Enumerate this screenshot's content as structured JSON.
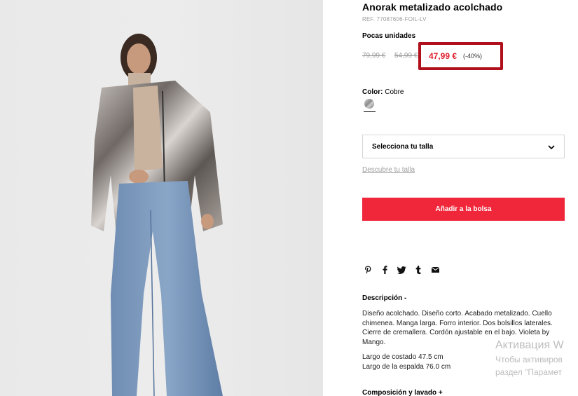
{
  "product": {
    "title": "Anorak metalizado acolchado",
    "ref": "REF. 77087606-FOIL-LV",
    "stock_status": "Pocas unidades",
    "prices": {
      "original_1": "79,99 €",
      "original_2": "54,99 €",
      "current": "47,99 €",
      "discount": "(-40%)"
    },
    "highlight_color": "#b0101c",
    "sale_color": "#e0202f"
  },
  "color": {
    "label": "Color:",
    "value": "Cobre"
  },
  "size": {
    "select_label": "Selecciona tu talla",
    "guide_link": "Descubre tu talla"
  },
  "cta": {
    "add_to_bag": "Añadir a la bolsa",
    "color": "#f0263a"
  },
  "share_icons": [
    "pinterest-icon",
    "facebook-icon",
    "twitter-icon",
    "tumblr-icon",
    "email-icon"
  ],
  "description": {
    "heading": "Descripción -",
    "text": "Diseño acolchado. Diseño corto. Acabado metalizado. Cuello chimenea. Manga larga. Forro interior. Dos bolsillos laterales. Cierre de cremallera. Cordón ajustable en el bajo. Violeta by Mango.",
    "measure_1": "Largo de costado 47.5 cm",
    "measure_2": "Largo de la espalda 76.0 cm"
  },
  "composition": {
    "heading": "Composición y lavado +"
  },
  "os_watermark": {
    "line1": "Активация W",
    "line2": "Чтобы активиров",
    "line3": "раздел \"Парамет"
  }
}
